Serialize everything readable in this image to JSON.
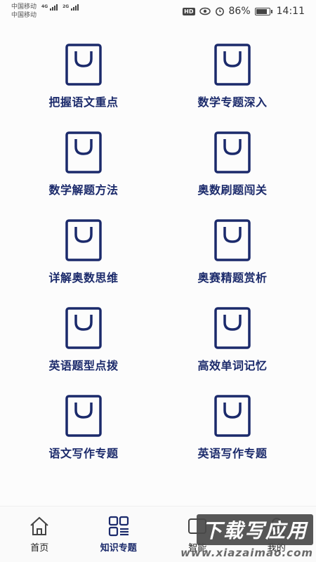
{
  "status_bar": {
    "carrier1": "中国移动",
    "carrier2": "中国移动",
    "net1": "4G",
    "net2": "2G",
    "hd": "HD",
    "battery": "86%",
    "time": "14:11"
  },
  "tiles": [
    {
      "label": "把握语文重点",
      "icon": "shopping-bag-icon"
    },
    {
      "label": "数学专题深入",
      "icon": "shopping-bag-icon"
    },
    {
      "label": "数学解题方法",
      "icon": "shopping-bag-icon"
    },
    {
      "label": "奥数刷题闯关",
      "icon": "shopping-bag-icon"
    },
    {
      "label": "详解奥数思维",
      "icon": "shopping-bag-icon"
    },
    {
      "label": "奥赛精题赏析",
      "icon": "shopping-bag-icon"
    },
    {
      "label": "英语题型点拨",
      "icon": "shopping-bag-icon"
    },
    {
      "label": "高效单词记忆",
      "icon": "shopping-bag-icon"
    },
    {
      "label": "语文写作专题",
      "icon": "shopping-bag-icon"
    },
    {
      "label": "英语写作专题",
      "icon": "shopping-bag-icon"
    }
  ],
  "bottom_nav": [
    {
      "label": "首页",
      "icon": "home-icon"
    },
    {
      "label": "知识专题",
      "icon": "grid-list-icon"
    },
    {
      "label": "智能",
      "icon": "device-icon"
    },
    {
      "label": "我的",
      "icon": "user-icon"
    }
  ],
  "watermark": {
    "title": "下载写应用",
    "url": "www.xiazaimao.com"
  },
  "colors": {
    "accent": "#1b2a6b",
    "background": "#fcfcfc"
  },
  "battery_level": 0.86
}
